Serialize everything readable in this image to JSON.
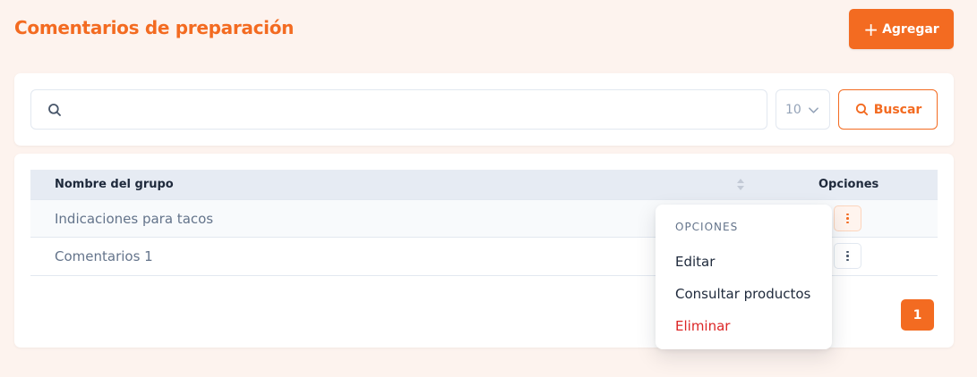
{
  "header": {
    "title": "Comentarios de preparación",
    "add_label": "Agregar",
    "add_icon": "plus-icon"
  },
  "search": {
    "value": "",
    "placeholder": "",
    "icon": "search-icon",
    "page_size": "10",
    "button_label": "Buscar"
  },
  "table": {
    "columns": [
      "Nombre del grupo",
      "Opciones"
    ],
    "rows": [
      {
        "name": "Indicaciones para tacos"
      },
      {
        "name": "Comentarios 1"
      }
    ]
  },
  "pagination": {
    "current_page": "1"
  },
  "menu": {
    "header": "OPCIONES",
    "items": [
      "Editar",
      "Consultar productos",
      "Eliminar"
    ]
  },
  "colors": {
    "accent": "#f36b21",
    "background": "#fdf3ee",
    "danger": "#dc2626"
  }
}
